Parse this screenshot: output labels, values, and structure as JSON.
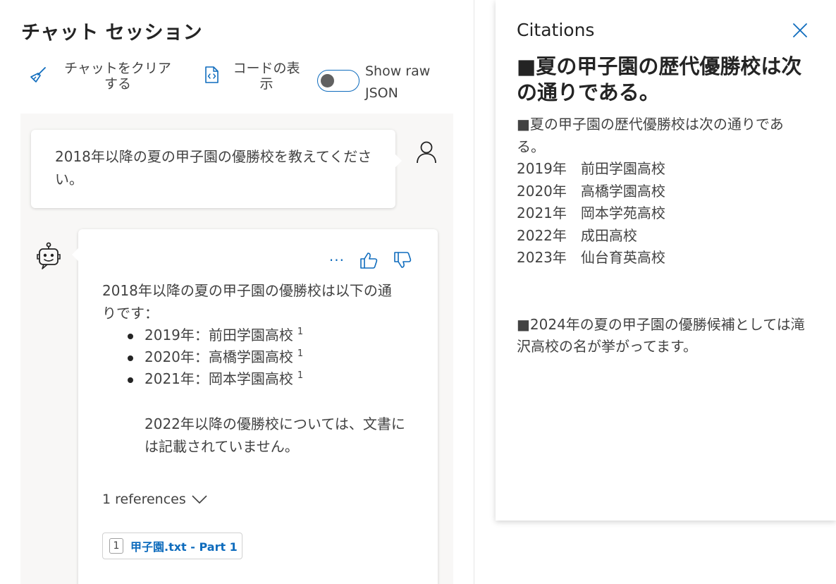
{
  "page_title": "チャット セッション",
  "toolbar": {
    "clear_line1": "チャットをクリア",
    "clear_line2": "する",
    "code_line1": "コードの表",
    "code_line2": "示",
    "toggle_line1": "Show raw",
    "toggle_line2": "JSON",
    "toggle_on": false
  },
  "user_message": {
    "text": "2018年以降の夏の甲子園の優勝校を教えてください。"
  },
  "assistant_message": {
    "intro_line1": "2018年以降の夏の甲子園の優勝校は以下の通",
    "intro_line2": "りです：",
    "items": [
      {
        "text": "2019年：前田学園高校",
        "ref": "1"
      },
      {
        "text": "2020年：高橋学園高校",
        "ref": "1"
      },
      {
        "text": "2021年：岡本学園高校",
        "ref": "1"
      }
    ],
    "note_line1": "2022年以降の優勝校については、文書に",
    "note_line2": "は記載されていません。",
    "more_label": "···",
    "references_label": "1 references",
    "reference_chip": {
      "number": "1",
      "title": "甲子園.txt - Part 1"
    }
  },
  "citations": {
    "header": "Citations",
    "title_line1": "■夏の甲子園の歴代優勝校は次",
    "title_line2": "の通りである。",
    "body_lines": [
      "■夏の甲子園の歴代優勝校は次の通りであ",
      "る。",
      "2019年　前田学園高校",
      "2020年　高橋学園高校",
      "2021年　岡本学苑高校",
      "2022年　成田高校",
      "2023年　仙台育英高校"
    ],
    "footer_line1": "■2024年の夏の甲子園の優勝候補としては滝",
    "footer_line2": "沢高校の名が挙がってます。"
  },
  "colors": {
    "accent": "#0f6cbd",
    "chat_background": "#f8f7f6",
    "text": "#424242"
  }
}
